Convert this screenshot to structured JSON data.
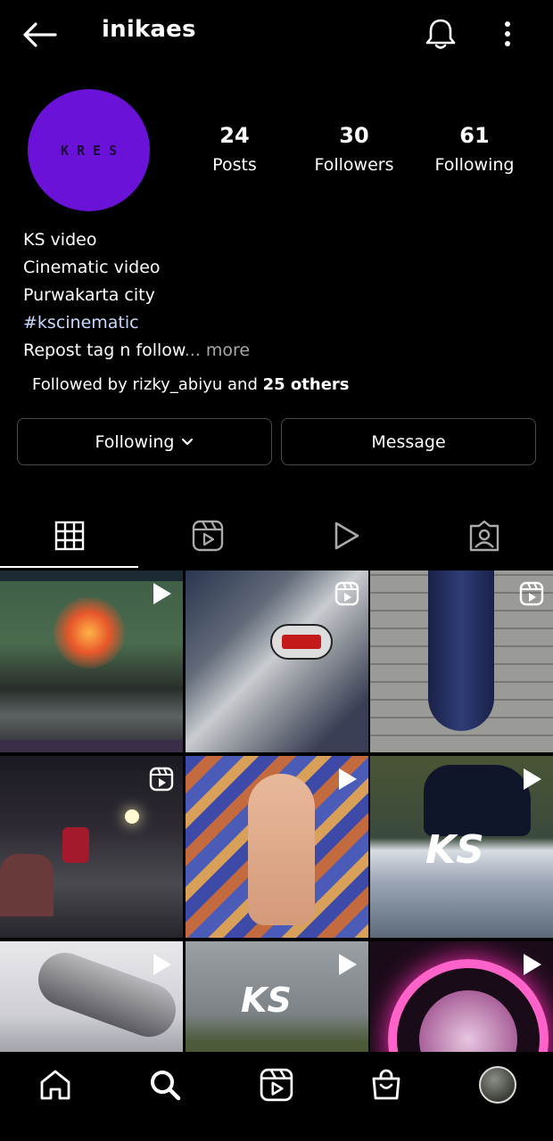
{
  "header": {
    "username": "inikaes"
  },
  "profile": {
    "avatar_text": "KRES",
    "avatar_color": "#6a12d8",
    "stats": [
      {
        "value": "24",
        "label": "Posts"
      },
      {
        "value": "30",
        "label": "Followers"
      },
      {
        "value": "61",
        "label": "Following"
      }
    ],
    "bio": {
      "line1": "KS video",
      "line2": "Cinematic video",
      "line3": "Purwakarta city",
      "hashtag": "#kscinematic",
      "line5": "Repost tag n follow",
      "more": "... more"
    },
    "followed_by": {
      "prefix": "Followed by ",
      "user": "rizky_abiyu",
      "joiner": " and ",
      "others": "25 others"
    }
  },
  "buttons": {
    "following_label": "Following",
    "message_label": "Message"
  },
  "tabs": [
    "grid-icon",
    "reels-icon",
    "play-icon",
    "tagged-icon"
  ],
  "posts": [
    {
      "name": "post-game-clip",
      "badge": "play-icon"
    },
    {
      "name": "post-exhaust-wrx",
      "badge": "reels-icon"
    },
    {
      "name": "post-tire",
      "badge": "reels-icon"
    },
    {
      "name": "post-night-ride",
      "badge": "reels-icon"
    },
    {
      "name": "post-hand",
      "badge": "play-icon"
    },
    {
      "name": "post-scooter-ks",
      "badge": "play-icon"
    },
    {
      "name": "post-exhaust-2",
      "badge": "play-icon"
    },
    {
      "name": "post-field-ks",
      "badge": "play-icon"
    },
    {
      "name": "post-neon-wheel",
      "badge": "play-icon"
    }
  ],
  "bottom_nav": [
    "home-icon",
    "search-icon",
    "reels-icon",
    "shop-icon",
    "profile-avatar"
  ]
}
